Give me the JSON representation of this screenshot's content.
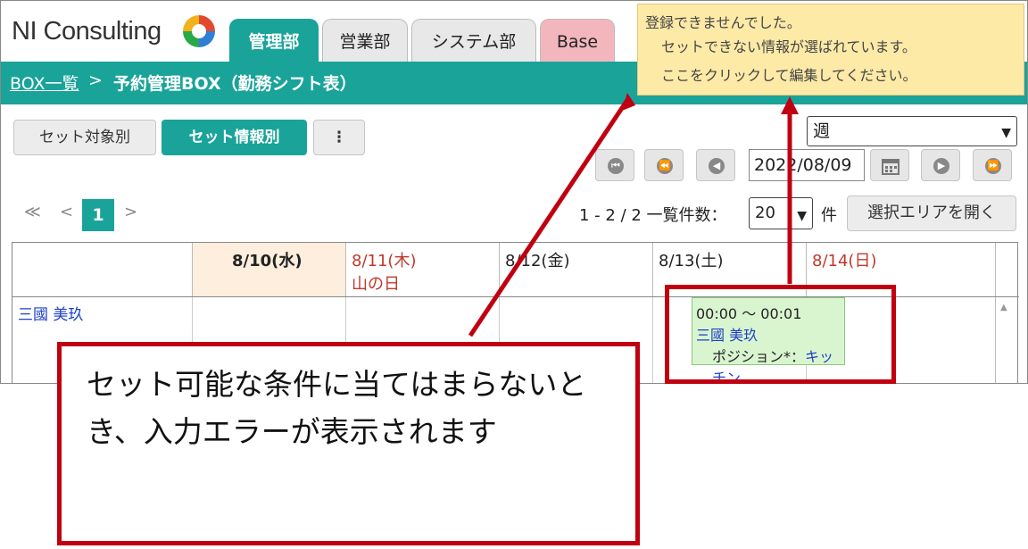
{
  "app": {
    "logo_text": "NI Consulting"
  },
  "tabs": [
    {
      "label": "管理部",
      "active": true
    },
    {
      "label": "営業部",
      "active": false
    },
    {
      "label": "システム部",
      "active": false
    },
    {
      "label": "Base",
      "active": false
    }
  ],
  "breadcrumb": {
    "link": "BOX一覧",
    "separator": ">",
    "current": "予約管理BOX（勤務シフト表）"
  },
  "toolbar": {
    "by_target_label": "セット対象別",
    "by_info_label": "セット情報別",
    "more_label": "⋮",
    "period_select": "週",
    "date_value": "2022/08/09",
    "open_select_area_label": "選択エリアを開く"
  },
  "pager": {
    "first": "≪",
    "prev": "<",
    "current_page": "1",
    "next": ">",
    "count_text": "1 - 2 / 2  一覧件数：",
    "page_size": "20",
    "unit": "件"
  },
  "grid": {
    "days": [
      {
        "date": "8/10(水)",
        "sub": "",
        "today": true,
        "holiday": false
      },
      {
        "date": "8/11(木)",
        "sub": "山の日",
        "today": false,
        "holiday": true
      },
      {
        "date": "8/12(金)",
        "sub": "",
        "today": false,
        "holiday": false
      },
      {
        "date": "8/13(土)",
        "sub": "",
        "today": false,
        "holiday": false
      },
      {
        "date": "8/14(日)",
        "sub": "",
        "today": false,
        "holiday": true
      }
    ],
    "rows": [
      {
        "name": "三國 美玖"
      }
    ],
    "shift": {
      "time": "00:00 ～ 00:01",
      "name": "三國 美玖",
      "position_label": "ポジション*：",
      "position_value": "キッチン"
    }
  },
  "error_tooltip": {
    "line1": "登録できませんでした。",
    "line2": "セットできない情報が選ばれています。",
    "line3": "ここをクリックして編集してください。"
  },
  "annotation": {
    "text": "セット可能な条件に当てはまらないとき、入力エラーが表示されます"
  },
  "colors": {
    "accent": "#1aa399",
    "annotation_red": "#c00010",
    "tooltip_bg": "#fdeaa7"
  }
}
